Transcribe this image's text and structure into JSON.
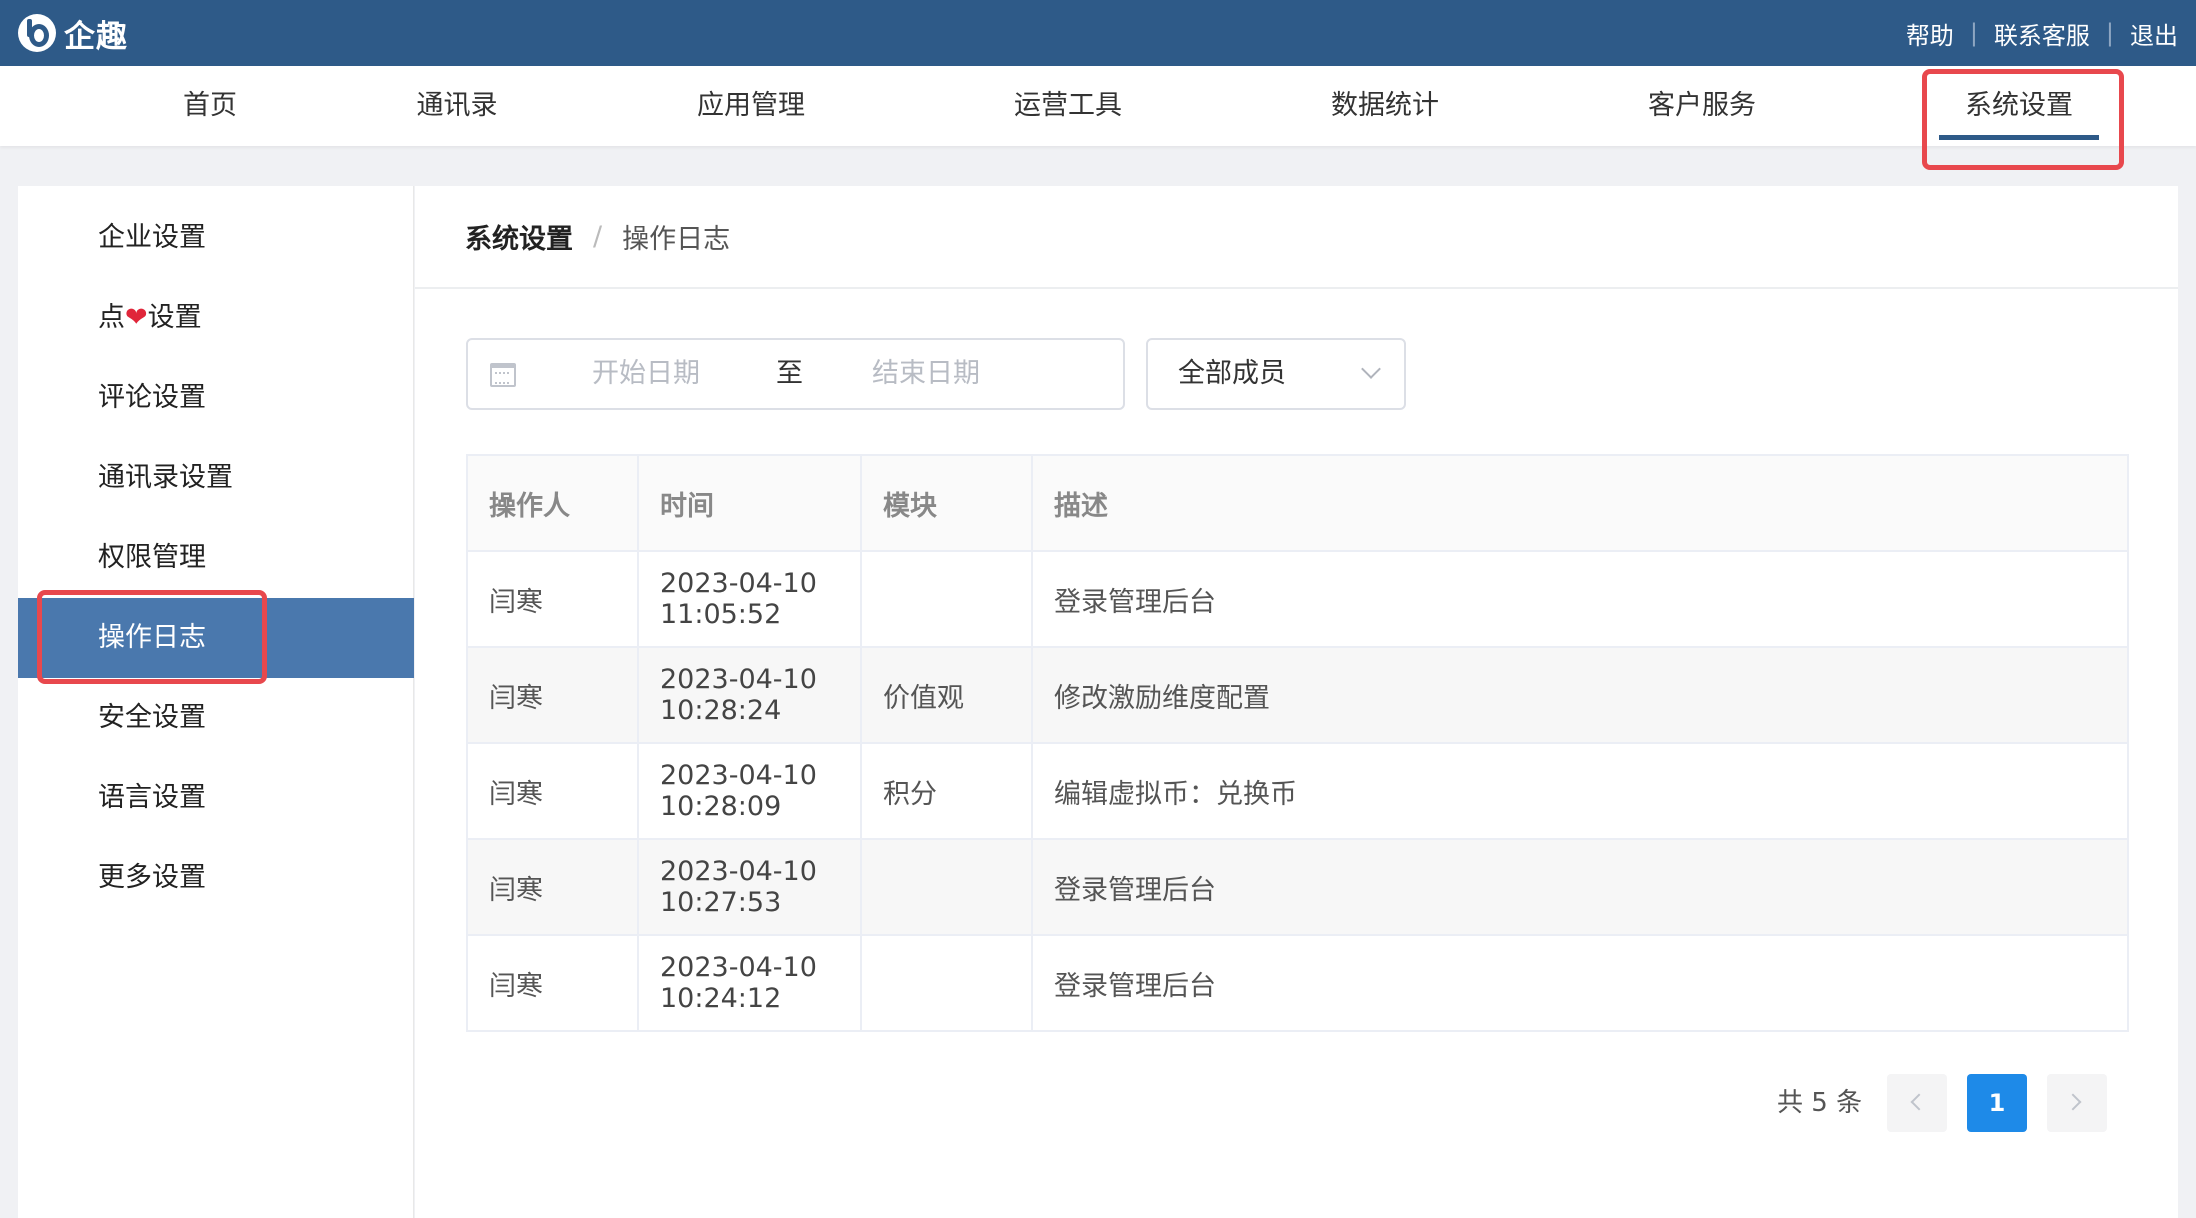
{
  "brand": {
    "name": "企趣"
  },
  "top_links": {
    "help": "帮助",
    "contact": "联系客服",
    "logout": "退出",
    "separator": "|"
  },
  "nav": {
    "items": [
      {
        "label": "首页"
      },
      {
        "label": "通讯录"
      },
      {
        "label": "应用管理"
      },
      {
        "label": "运营工具"
      },
      {
        "label": "数据统计"
      },
      {
        "label": "客户服务"
      },
      {
        "label": "系统设置",
        "active": true
      }
    ]
  },
  "sidebar": {
    "items": [
      {
        "label": "企业设置"
      },
      {
        "label_pre": "点",
        "label_icon": "❤",
        "label_post": "设置",
        "icon_name": "heart-icon"
      },
      {
        "label": "评论设置"
      },
      {
        "label": "通讯录设置"
      },
      {
        "label": "权限管理"
      },
      {
        "label": "操作日志",
        "active": true
      },
      {
        "label": "安全设置"
      },
      {
        "label": "语言设置"
      },
      {
        "label": "更多设置"
      }
    ]
  },
  "breadcrumb": {
    "root": "系统设置",
    "separator": "/",
    "current": "操作日志"
  },
  "filters": {
    "date_start_placeholder": "开始日期",
    "date_to": "至",
    "date_end_placeholder": "结束日期",
    "member_select": "全部成员"
  },
  "table": {
    "headers": [
      "操作人",
      "时间",
      "模块",
      "描述"
    ],
    "rows": [
      [
        "闫寒",
        "2023-04-10 11:05:52",
        "",
        "登录管理后台"
      ],
      [
        "闫寒",
        "2023-04-10 10:28:24",
        "价值观",
        "修改激励维度配置"
      ],
      [
        "闫寒",
        "2023-04-10 10:28:09",
        "积分",
        "编辑虚拟币：兑换币"
      ],
      [
        "闫寒",
        "2023-04-10 10:27:53",
        "",
        "登录管理后台"
      ],
      [
        "闫寒",
        "2023-04-10 10:24:12",
        "",
        "登录管理后台"
      ]
    ]
  },
  "pagination": {
    "total": "共 5 条",
    "current": "1"
  },
  "colors": {
    "header_bg": "#2e5a88",
    "active_side": "#4a78ad",
    "highlight": "#e8484d",
    "page_active": "#1e8ae8"
  }
}
